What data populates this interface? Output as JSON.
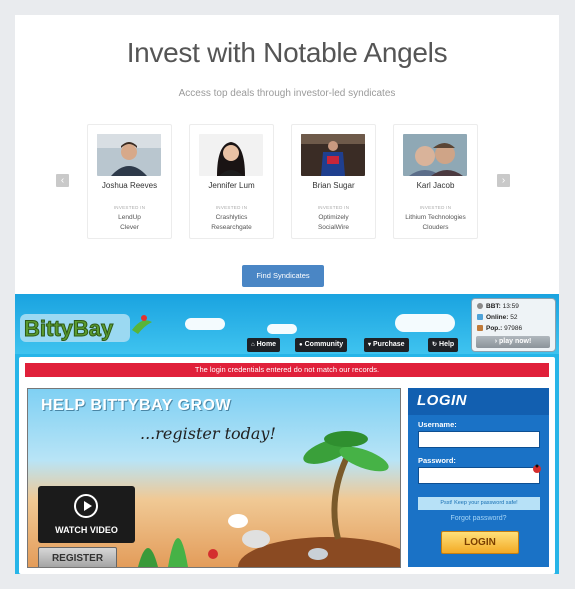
{
  "angel": {
    "title": "Invest with Notable Angels",
    "subtitle": "Access top deals through investor-led syndicates",
    "nav_prev": "‹",
    "nav_next": "›",
    "investors": [
      {
        "name": "Joshua Reeves",
        "invested_label": "INVESTED IN",
        "companies": [
          "LendUp",
          "Clever"
        ]
      },
      {
        "name": "Jennifer Lum",
        "invested_label": "INVESTED IN",
        "companies": [
          "Crashlytics",
          "Researchgate"
        ]
      },
      {
        "name": "Brian Sugar",
        "invested_label": "INVESTED IN",
        "companies": [
          "Optimizely",
          "SocialWire"
        ]
      },
      {
        "name": "Karl Jacob",
        "invested_label": "INVESTED IN",
        "companies": [
          "Lithium Technologies",
          "Clouders"
        ]
      }
    ],
    "button_label": "Find Syndicates",
    "accent_color": "#4a86c5"
  },
  "bitty": {
    "stats": [
      {
        "icon": "bbt-icon",
        "label": "BBT:",
        "value": "13:59"
      },
      {
        "icon": "online-icon",
        "label": "Online:",
        "value": "52"
      },
      {
        "icon": "population-icon",
        "label": "Pop.:",
        "value": "97986"
      }
    ],
    "play_label": "› play now!",
    "nav": [
      {
        "icon": "home-icon",
        "label": "Home"
      },
      {
        "icon": "community-icon",
        "label": "Community"
      },
      {
        "icon": "cart-icon",
        "label": "Purchase"
      },
      {
        "icon": "help-icon",
        "label": "Help"
      }
    ],
    "error": "The login credentials entered do not match our records.",
    "promo": {
      "headline": "HELP BITTYBAY GROW",
      "script": "...register today!",
      "video_label": "WATCH VIDEO",
      "register_label": "REGISTER"
    },
    "login": {
      "title": "LOGIN",
      "username_label": "Username:",
      "username_value": "",
      "password_label": "Password:",
      "password_value": "",
      "tip": "Psst! Keep your password safe!",
      "forgot": "Forgot password?",
      "button": "LOGIN"
    },
    "colors": {
      "sky": "#27b5e8",
      "error": "#e0203a",
      "login_bg": "#1a72c6"
    }
  }
}
